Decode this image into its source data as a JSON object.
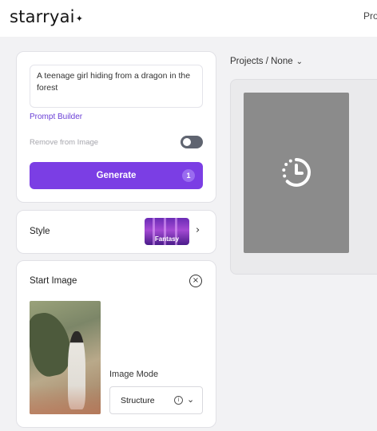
{
  "header": {
    "logo_text": "starryai",
    "logo_mark": "✦",
    "nav_link": "Pro"
  },
  "prompt_card": {
    "prompt_text": "A teenage girl hiding from a dragon in the forest",
    "prompt_builder_label": "Prompt Builder",
    "remove_from_image_label": "Remove from Image",
    "remove_toggle_on": false,
    "generate_label": "Generate",
    "generate_count": "1"
  },
  "style_card": {
    "label": "Style",
    "selected_style": "Fantasy",
    "chevron": "›"
  },
  "start_image_card": {
    "title": "Start Image",
    "close_glyph": "×",
    "image_mode_label": "Image Mode",
    "image_mode_value": "Structure",
    "info_glyph": "i",
    "select_chevron": "⌄"
  },
  "projects": {
    "label": "Projects / None",
    "chevron": "⌄"
  },
  "colors": {
    "accent": "#7b3ee4",
    "link": "#6a3fd6",
    "toggle_off": "#5f6470",
    "pending_tile": "#8b8b8b"
  },
  "icons": {
    "close": "close-circle-icon",
    "pending": "clock-pending-icon",
    "info": "info-icon",
    "chevron": "chevron-down-icon"
  }
}
